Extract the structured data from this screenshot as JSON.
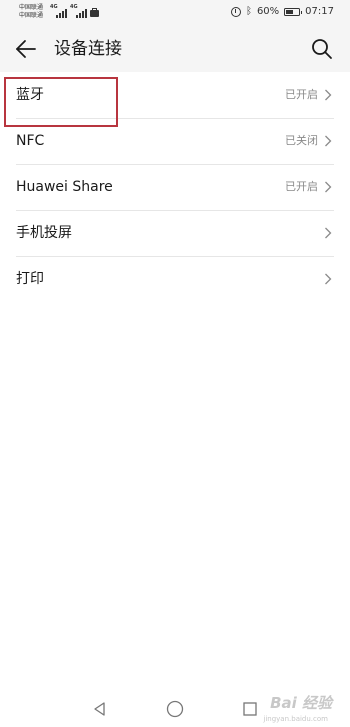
{
  "status_bar": {
    "carrier_1": "中国联通",
    "carrier_2": "中国联通",
    "network_1": "4G",
    "network_2": "4G",
    "battery": "60%",
    "battery_level": 0.6,
    "time": "07:17"
  },
  "header": {
    "title": "设备连接"
  },
  "settings": [
    {
      "label": "蓝牙",
      "status": "已开启"
    },
    {
      "label": "NFC",
      "status": "已关闭"
    },
    {
      "label": "Huawei Share",
      "status": "已开启"
    },
    {
      "label": "手机投屏",
      "status": ""
    },
    {
      "label": "打印",
      "status": ""
    }
  ],
  "watermark": {
    "text": "Bai 经验",
    "subtext": "jingyan.baidu.com"
  },
  "colors": {
    "highlight_border": "#b8353f",
    "header_bg": "#f5f5f5",
    "status_text": "#8a8a8a"
  },
  "icons": {
    "back": "arrow-left-icon",
    "search": "magnifier-icon",
    "chevron": "chevron-right-icon"
  }
}
